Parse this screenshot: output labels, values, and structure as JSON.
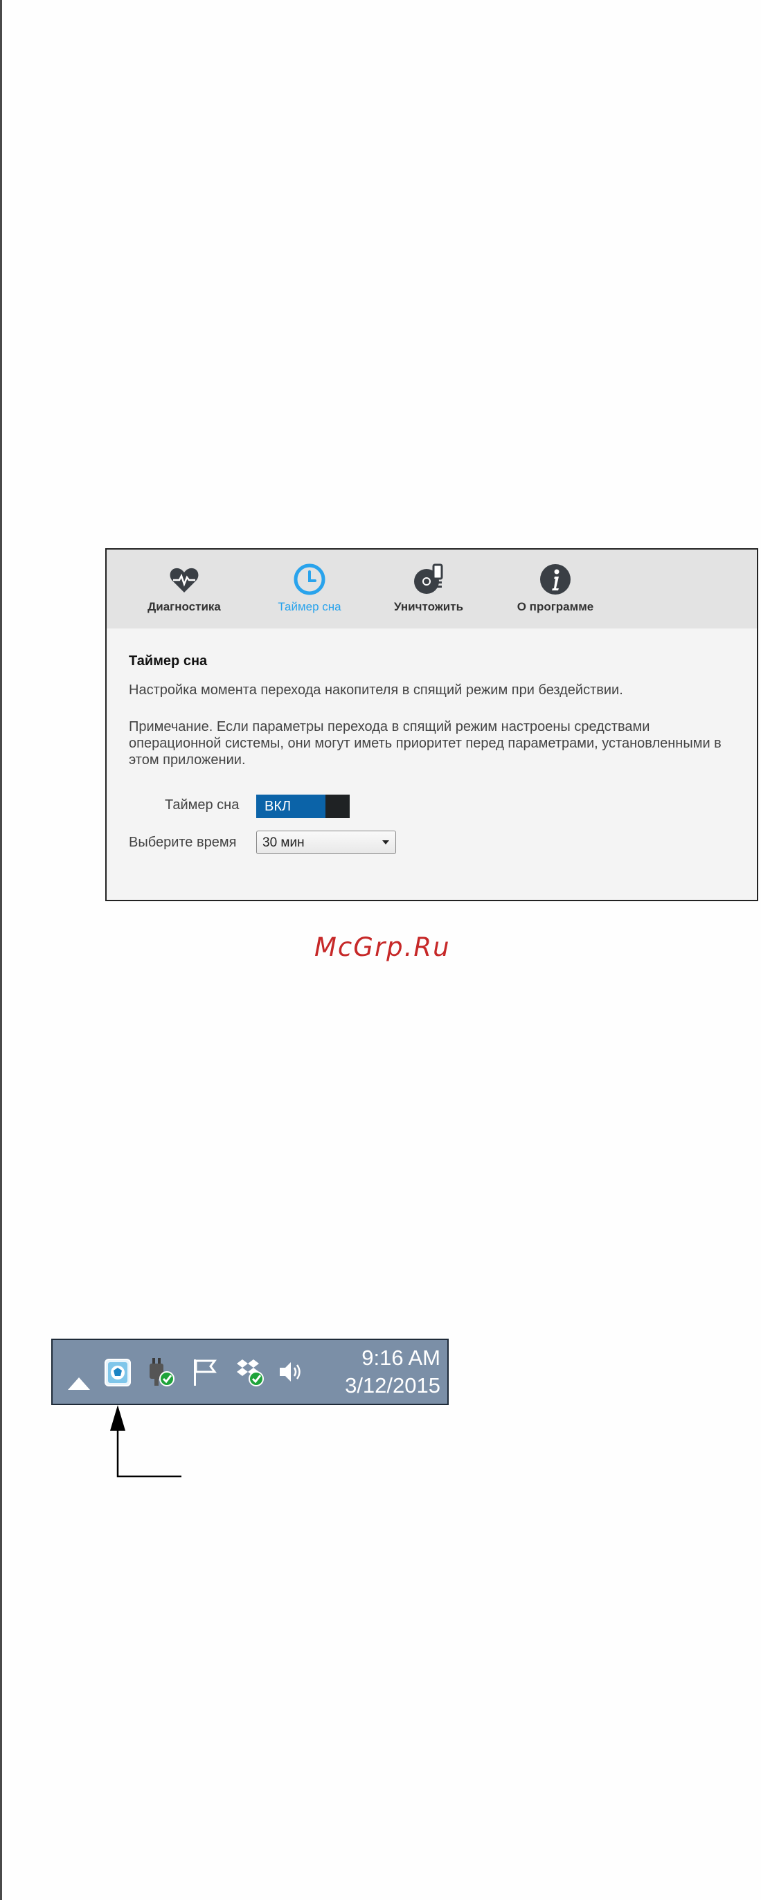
{
  "app": {
    "tabs": [
      {
        "label": "Диагностика",
        "icon": "heart-pulse-icon"
      },
      {
        "label": "Таймер сна",
        "icon": "clock-icon",
        "active": true
      },
      {
        "label": "Уничтожить",
        "icon": "disk-erase-icon"
      },
      {
        "label": "О программе",
        "icon": "info-icon"
      }
    ],
    "section_title": "Таймер сна",
    "description": "Настройка момента перехода накопителя в спящий режим при бездействии.",
    "note": "Примечание. Если параметры перехода в спящий режим настроены средствами операционной системы, они могут иметь приоритет перед параметрами, установленными в этом приложении.",
    "sleep_timer": {
      "label": "Таймер сна",
      "toggle_state": "ВКЛ"
    },
    "time_select": {
      "label": "Выберите время",
      "value": "30 мин"
    },
    "colors": {
      "active_tab": "#29a3ec",
      "toggle_on": "#0b63a8"
    }
  },
  "watermark": "McGrp.Ru",
  "taskbar": {
    "icons": [
      "show-hidden-icons-arrow",
      "wd-drive-utilities-icon",
      "power-icon",
      "action-center-flag-icon",
      "dropbox-icon",
      "volume-icon"
    ],
    "time": "9:16 AM",
    "date": "3/12/2015"
  }
}
